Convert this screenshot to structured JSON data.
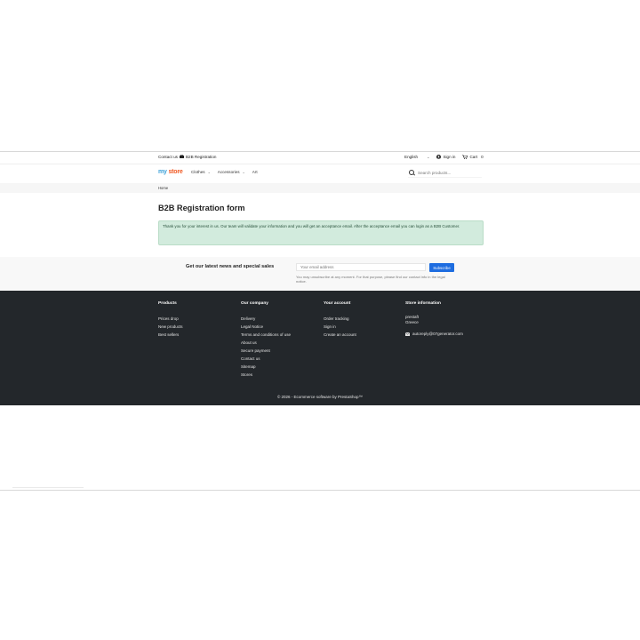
{
  "topbar": {
    "contact_label": "Contact us",
    "b2b_label": "B2B Registration",
    "language": "English",
    "sign_in": "Sign in",
    "cart_label": "Cart",
    "cart_count": "0"
  },
  "header": {
    "logo_part1": "my",
    "logo_part2": "store",
    "nav": [
      {
        "label": "Clothes"
      },
      {
        "label": "Accessories"
      },
      {
        "label": "Art"
      }
    ],
    "search_placeholder": "Search products..."
  },
  "breadcrumb": {
    "home": "Home"
  },
  "main": {
    "title": "B2B Registration form",
    "alert": "Thank you for your interest in us. Our team will validate your information and you will get an acceptance email. After the acceptance email you can login as a B2B Customer."
  },
  "newsletter": {
    "heading": "Get our latest news and special sales",
    "placeholder": "Your email address",
    "subscribe": "Subscribe",
    "note": "You may unsubscribe at any moment. For that purpose, please find our contact info in the legal notice."
  },
  "footer": {
    "products": {
      "title": "Products",
      "links": [
        "Prices drop",
        "New products",
        "Best sellers"
      ]
    },
    "company": {
      "title": "Our company",
      "links": [
        "Delivery",
        "Legal Notice",
        "Terms and conditions of use",
        "About us",
        "Secure payment",
        "Contact us",
        "Sitemap",
        "Stores"
      ]
    },
    "account": {
      "title": "Your account",
      "links": [
        "Order tracking",
        "Sign in",
        "Create an account"
      ]
    },
    "store": {
      "title": "Store information",
      "name": "prestaft",
      "country": "Greece",
      "email": "autoreply@07generator.com"
    },
    "copyright": "© 2026 - Ecommerce software by PrestaShop™"
  },
  "colors": {
    "accent": "#1e6de0",
    "footer_bg": "#23272b",
    "alert_bg": "#d2ebdd"
  }
}
